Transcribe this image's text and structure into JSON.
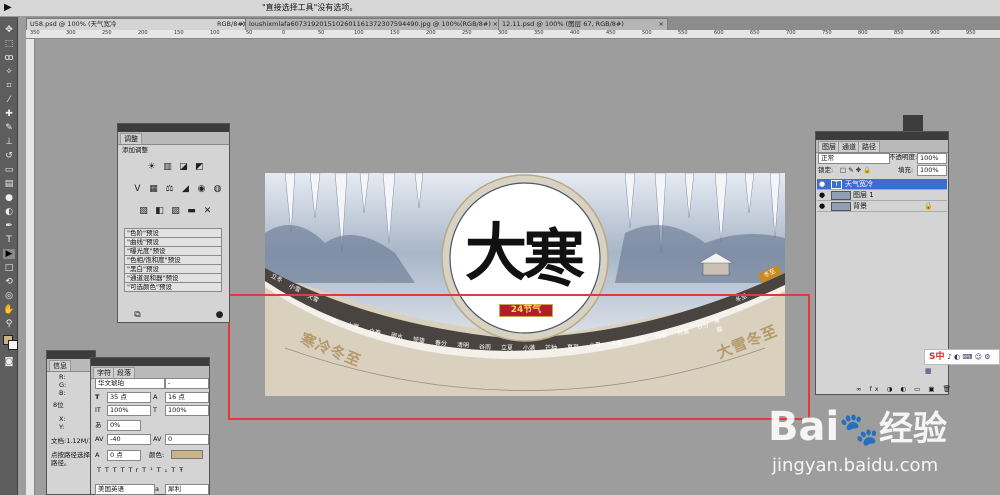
{
  "app": {
    "current_tool": "▶",
    "option_hint": "\"直接选择工具\"没有选项。"
  },
  "tabs": [
    {
      "label": "U58.psd @ 100% (天气宽冷"
    },
    {
      "label": "RGB/8#) *"
    },
    {
      "label": "loushixmlafa6073192015102601161372307594490.jpg @ 100%(RGB/8#)"
    },
    {
      "label": "12.11.psd @ 100% (图层 67, RGB/8#)"
    }
  ],
  "ruler_ticks": [
    "350",
    "300",
    "250",
    "200",
    "150",
    "100",
    "50",
    "0",
    "50",
    "100",
    "150",
    "200",
    "250",
    "300",
    "350",
    "400",
    "450",
    "500",
    "550",
    "600",
    "650",
    "700",
    "750",
    "800",
    "850",
    "900",
    "950"
  ],
  "adjust_panel": {
    "tab": "调整",
    "heading": "添加调整",
    "presets": [
      "\"色阶\"预设",
      "\"曲线\"预设",
      "\"曝光度\"预设",
      "\"色相/饱和度\"预设",
      "\"黑白\"预设",
      "\"通道混和器\"预设",
      "\"可选颜色\"预设"
    ]
  },
  "info_panel": {
    "tab": "信息",
    "labels": [
      "R:",
      "G:",
      "B:",
      "8位",
      "X:",
      "Y:"
    ],
    "doc": "文档:1.12M/1",
    "hint1": "点按路径选择",
    "hint2": "路径。"
  },
  "char_panel": {
    "tab_char": "字符",
    "tab_para": "段落",
    "font": "华文琥珀",
    "style": "-",
    "size": "35 点",
    "leading": "16 点",
    "vscale": "100%",
    "hscale": "100%",
    "tracking_pct": "0%",
    "kerning": "-40",
    "tracking": "0",
    "baseline": "0 点",
    "color_label": "颜色:",
    "lang": "美国英语",
    "aa": "犀利",
    "styles": [
      "T",
      "T",
      "TT",
      "Tr",
      "T¹",
      "T₁",
      "T",
      "Ŧ"
    ]
  },
  "layers_panel": {
    "tabs": [
      "图层",
      "通道",
      "路径"
    ],
    "blend": "正常",
    "opacity_label": "不透明度:",
    "opacity": "100%",
    "lock_label": "锁定:",
    "fill_label": "填充:",
    "fill": "100%",
    "layers": [
      {
        "name": "天气宽冷",
        "selected": true
      },
      {
        "name": "图层 1",
        "selected": false
      },
      {
        "name": "背景",
        "selected": false
      }
    ]
  },
  "canvas": {
    "title_chars": [
      "大",
      "寒"
    ],
    "badge": "24节气",
    "seal": "冬至",
    "left_deco": "寒冷冬至",
    "right_deco": "大雪冬至",
    "terms_upper": [
      "立冬",
      "小雪",
      "大雪",
      "冬至"
    ],
    "terms_lower": [
      "小寒",
      "大寒",
      "立春",
      "雨水",
      "惊蛰",
      "春分",
      "清明",
      "谷雨",
      "立夏",
      "小满",
      "芒种",
      "夏至",
      "小暑",
      "大暑",
      "立秋",
      "处暑",
      "白露",
      "秋分",
      "寒露",
      "霜降",
      "立冬",
      "小雪",
      "大雪"
    ]
  },
  "ime": {
    "label": "S中",
    "extra": "♪ ◐ ⌨ ☺ ⚙ ▦"
  },
  "watermark": {
    "brand": "Bai",
    "brand2": "经验",
    "url": "jingyan.baidu.com"
  },
  "colors": {
    "selection": "#e23a3a",
    "accent_red": "#b0202a",
    "layer_sel": "#3a6fd0"
  }
}
